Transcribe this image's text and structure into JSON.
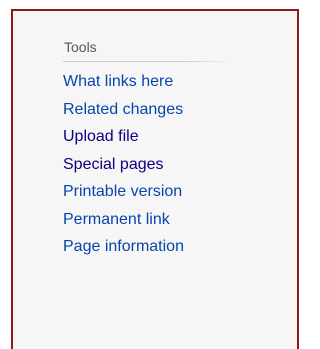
{
  "tools": {
    "heading": "Tools",
    "items": [
      {
        "label": "What links here",
        "color": "#0645ad"
      },
      {
        "label": "Related changes",
        "color": "#0645ad"
      },
      {
        "label": "Upload file",
        "color": "#0b0080"
      },
      {
        "label": "Special pages",
        "color": "#0b0080"
      },
      {
        "label": "Printable version",
        "color": "#0645ad"
      },
      {
        "label": "Permanent link",
        "color": "#0645ad"
      },
      {
        "label": "Page information",
        "color": "#0645ad"
      }
    ]
  },
  "colors": {
    "frame_border": "#8b1a1a",
    "panel_background": "#f6f6f6",
    "heading_text": "#54595d",
    "link": "#0645ad",
    "visited_link": "#0b0080"
  }
}
